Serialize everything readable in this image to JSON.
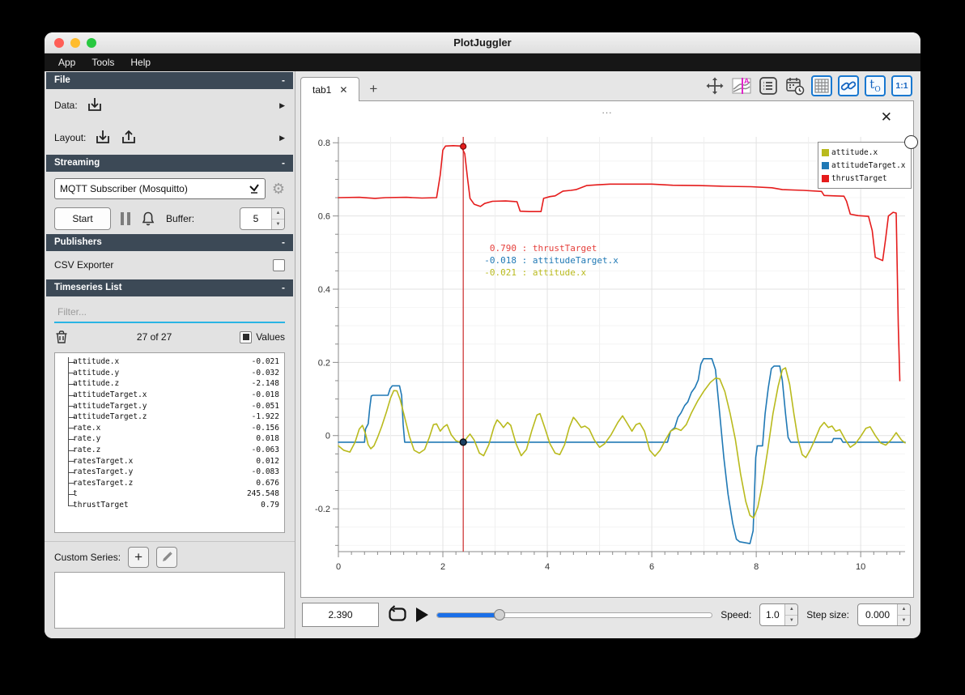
{
  "window": {
    "title": "PlotJuggler",
    "menu": [
      "App",
      "Tools",
      "Help"
    ]
  },
  "icons": {
    "collapse": "-",
    "expander": "▶",
    "gear": "⚙",
    "close": "✕",
    "add": "+",
    "dots": "...",
    "up": "▲",
    "down": "▼"
  },
  "sidebar": {
    "sections": {
      "file": "File",
      "streaming": "Streaming",
      "publishers": "Publishers",
      "timeseries": "Timeseries List"
    },
    "file": {
      "data_label": "Data:",
      "layout_label": "Layout:"
    },
    "streaming": {
      "source": "MQTT Subscriber (Mosquitto)",
      "start_label": "Start",
      "buffer_label": "Buffer:",
      "buffer_value": "5"
    },
    "publishers": {
      "csv_label": "CSV Exporter",
      "csv_checked": false
    },
    "timeseries": {
      "filter_placeholder": "Filter...",
      "count": "27 of 27",
      "values_label": "Values",
      "values_checked": true,
      "items": [
        {
          "name": "attitude.x",
          "value": "-0.021"
        },
        {
          "name": "attitude.y",
          "value": "-0.032"
        },
        {
          "name": "attitude.z",
          "value": "-2.148"
        },
        {
          "name": "attitudeTarget.x",
          "value": "-0.018"
        },
        {
          "name": "attitudeTarget.y",
          "value": "-0.051"
        },
        {
          "name": "attitudeTarget.z",
          "value": "-1.922"
        },
        {
          "name": "rate.x",
          "value": "-0.156"
        },
        {
          "name": "rate.y",
          "value": "0.018"
        },
        {
          "name": "rate.z",
          "value": "-0.063"
        },
        {
          "name": "ratesTarget.x",
          "value": "0.012"
        },
        {
          "name": "ratesTarget.y",
          "value": "-0.083"
        },
        {
          "name": "ratesTarget.z",
          "value": "0.676"
        },
        {
          "name": "t",
          "value": "245.548"
        },
        {
          "name": "thrustTarget",
          "value": "0.79"
        }
      ]
    },
    "custom_series_label": "Custom Series:"
  },
  "tabs": {
    "active": "tab1"
  },
  "toolbar": {
    "t_label": "t",
    "t_sub": "O",
    "ratio_label": "1:1"
  },
  "plot": {
    "title": "...",
    "legend": [
      {
        "label": "attitude.x",
        "color": "#b9ba1d"
      },
      {
        "label": "attitudeTarget.x",
        "color": "#2079b5"
      },
      {
        "label": "thrustTarget",
        "color": "#e51c1c"
      }
    ],
    "tooltip_lines": [
      {
        "num": " 0.790",
        "sep": " : ",
        "label": "thrustTarget",
        "color": "#e5403c"
      },
      {
        "num": "-0.018",
        "sep": " : ",
        "label": "attitudeTarget.x",
        "color": "#2079b5"
      },
      {
        "num": "-0.021",
        "sep": " : ",
        "label": "attitude.x",
        "color": "#b9ba1d"
      }
    ],
    "tracker": {
      "x": 2.39,
      "color": "#cc2a2a",
      "points": [
        {
          "v": 0.79,
          "fill": "#e51c1c",
          "stroke": "#7a1010",
          "r": 3.5
        },
        {
          "v": -0.018,
          "fill": "#1d3f61",
          "stroke": "#0a0a0a",
          "r": 4
        }
      ]
    }
  },
  "chart_data": {
    "type": "line",
    "title": "...",
    "xlabel": "",
    "ylabel": "",
    "xlim": [
      0,
      10.85
    ],
    "ylim": [
      -0.317,
      0.816
    ],
    "x_ticks": [
      0,
      2,
      4,
      6,
      8,
      10
    ],
    "y_ticks": [
      -0.2,
      0,
      0.2,
      0.4,
      0.6,
      0.8
    ],
    "grid": {
      "x_minor": 1,
      "x_major": 2,
      "y_minor": 0.05,
      "y_major": 0.2
    },
    "legend_position": "top-right",
    "series": [
      {
        "name": "thrustTarget",
        "color": "#e51c1c",
        "points": [
          [
            0,
            0.65
          ],
          [
            0.4,
            0.651
          ],
          [
            0.7,
            0.648
          ],
          [
            0.9,
            0.65
          ],
          [
            1.3,
            0.651
          ],
          [
            1.6,
            0.649
          ],
          [
            1.88,
            0.65
          ],
          [
            1.95,
            0.712
          ],
          [
            2.0,
            0.78
          ],
          [
            2.05,
            0.791
          ],
          [
            2.2,
            0.792
          ],
          [
            2.35,
            0.791
          ],
          [
            2.42,
            0.77
          ],
          [
            2.47,
            0.705
          ],
          [
            2.52,
            0.648
          ],
          [
            2.6,
            0.632
          ],
          [
            2.72,
            0.626
          ],
          [
            2.8,
            0.634
          ],
          [
            2.95,
            0.64
          ],
          [
            3.2,
            0.641
          ],
          [
            3.42,
            0.639
          ],
          [
            3.48,
            0.613
          ],
          [
            3.65,
            0.612
          ],
          [
            3.88,
            0.612
          ],
          [
            3.93,
            0.648
          ],
          [
            4.05,
            0.653
          ],
          [
            4.15,
            0.655
          ],
          [
            4.3,
            0.668
          ],
          [
            4.45,
            0.67
          ],
          [
            4.55,
            0.672
          ],
          [
            4.75,
            0.683
          ],
          [
            4.95,
            0.685
          ],
          [
            5.2,
            0.687
          ],
          [
            5.6,
            0.687
          ],
          [
            6.0,
            0.687
          ],
          [
            6.4,
            0.684
          ],
          [
            6.9,
            0.683
          ],
          [
            7.4,
            0.681
          ],
          [
            7.9,
            0.68
          ],
          [
            8.3,
            0.677
          ],
          [
            8.5,
            0.672
          ],
          [
            8.9,
            0.67
          ],
          [
            9.25,
            0.667
          ],
          [
            9.3,
            0.656
          ],
          [
            9.5,
            0.655
          ],
          [
            9.68,
            0.654
          ],
          [
            9.73,
            0.64
          ],
          [
            9.8,
            0.605
          ],
          [
            9.95,
            0.601
          ],
          [
            10.15,
            0.599
          ],
          [
            10.22,
            0.56
          ],
          [
            10.28,
            0.487
          ],
          [
            10.42,
            0.478
          ],
          [
            10.48,
            0.54
          ],
          [
            10.53,
            0.6
          ],
          [
            10.62,
            0.61
          ],
          [
            10.68,
            0.608
          ],
          [
            10.72,
            0.3
          ],
          [
            10.75,
            0.15
          ]
        ]
      },
      {
        "name": "attitudeTarget.x",
        "color": "#2079b5",
        "points": [
          [
            0,
            -0.018
          ],
          [
            0.5,
            -0.018
          ],
          [
            0.52,
            0.018
          ],
          [
            0.57,
            0.032
          ],
          [
            0.6,
            0.075
          ],
          [
            0.63,
            0.108
          ],
          [
            0.66,
            0.11
          ],
          [
            0.95,
            0.11
          ],
          [
            0.99,
            0.128
          ],
          [
            1.03,
            0.136
          ],
          [
            1.17,
            0.136
          ],
          [
            1.21,
            0.11
          ],
          [
            1.24,
            0.03
          ],
          [
            1.27,
            -0.018
          ],
          [
            6.3,
            -0.018
          ],
          [
            6.36,
            0.012
          ],
          [
            6.44,
            0.022
          ],
          [
            6.5,
            0.05
          ],
          [
            6.56,
            0.062
          ],
          [
            6.63,
            0.082
          ],
          [
            6.69,
            0.092
          ],
          [
            6.76,
            0.118
          ],
          [
            6.83,
            0.132
          ],
          [
            6.89,
            0.152
          ],
          [
            6.94,
            0.195
          ],
          [
            6.99,
            0.21
          ],
          [
            7.15,
            0.21
          ],
          [
            7.22,
            0.18
          ],
          [
            7.3,
            0.06
          ],
          [
            7.38,
            -0.06
          ],
          [
            7.46,
            -0.16
          ],
          [
            7.55,
            -0.24
          ],
          [
            7.62,
            -0.283
          ],
          [
            7.68,
            -0.29
          ],
          [
            7.88,
            -0.295
          ],
          [
            7.94,
            -0.26
          ],
          [
            7.99,
            -0.06
          ],
          [
            8.02,
            -0.028
          ],
          [
            8.12,
            -0.028
          ],
          [
            8.17,
            0.06
          ],
          [
            8.23,
            0.13
          ],
          [
            8.29,
            0.183
          ],
          [
            8.34,
            0.19
          ],
          [
            8.45,
            0.19
          ],
          [
            8.5,
            0.15
          ],
          [
            8.56,
            0.06
          ],
          [
            8.61,
            -0.005
          ],
          [
            8.66,
            -0.018
          ],
          [
            9.45,
            -0.018
          ],
          [
            9.48,
            -0.008
          ],
          [
            9.62,
            -0.008
          ],
          [
            9.66,
            -0.018
          ],
          [
            10.85,
            -0.018
          ]
        ]
      },
      {
        "name": "attitude.x",
        "color": "#b9ba1d",
        "points": [
          [
            0,
            -0.028
          ],
          [
            0.1,
            -0.04
          ],
          [
            0.22,
            -0.045
          ],
          [
            0.32,
            -0.018
          ],
          [
            0.4,
            0.018
          ],
          [
            0.46,
            0.028
          ],
          [
            0.52,
            0.005
          ],
          [
            0.57,
            -0.025
          ],
          [
            0.62,
            -0.036
          ],
          [
            0.68,
            -0.028
          ],
          [
            0.75,
            -0.005
          ],
          [
            0.83,
            0.025
          ],
          [
            0.92,
            0.065
          ],
          [
            1.0,
            0.103
          ],
          [
            1.06,
            0.123
          ],
          [
            1.12,
            0.122
          ],
          [
            1.18,
            0.1
          ],
          [
            1.26,
            0.055
          ],
          [
            1.36,
            -0.002
          ],
          [
            1.45,
            -0.04
          ],
          [
            1.55,
            -0.048
          ],
          [
            1.65,
            -0.038
          ],
          [
            1.74,
            -0.005
          ],
          [
            1.82,
            0.03
          ],
          [
            1.88,
            0.032
          ],
          [
            1.95,
            0.012
          ],
          [
            2.02,
            0.024
          ],
          [
            2.08,
            0.03
          ],
          [
            2.16,
            0.002
          ],
          [
            2.25,
            -0.014
          ],
          [
            2.39,
            -0.021
          ],
          [
            2.47,
            -0.004
          ],
          [
            2.52,
            0.004
          ],
          [
            2.6,
            -0.012
          ],
          [
            2.7,
            -0.048
          ],
          [
            2.78,
            -0.055
          ],
          [
            2.88,
            -0.025
          ],
          [
            2.98,
            0.025
          ],
          [
            3.04,
            0.043
          ],
          [
            3.1,
            0.034
          ],
          [
            3.16,
            0.022
          ],
          [
            3.24,
            0.036
          ],
          [
            3.3,
            0.028
          ],
          [
            3.4,
            -0.022
          ],
          [
            3.5,
            -0.055
          ],
          [
            3.6,
            -0.038
          ],
          [
            3.7,
            0.012
          ],
          [
            3.8,
            0.056
          ],
          [
            3.86,
            0.06
          ],
          [
            3.95,
            0.022
          ],
          [
            4.05,
            -0.022
          ],
          [
            4.15,
            -0.048
          ],
          [
            4.24,
            -0.052
          ],
          [
            4.33,
            -0.025
          ],
          [
            4.42,
            0.022
          ],
          [
            4.5,
            0.05
          ],
          [
            4.56,
            0.04
          ],
          [
            4.65,
            0.022
          ],
          [
            4.72,
            0.026
          ],
          [
            4.8,
            0.018
          ],
          [
            4.9,
            -0.012
          ],
          [
            5.0,
            -0.032
          ],
          [
            5.1,
            -0.022
          ],
          [
            5.22,
            0.002
          ],
          [
            5.35,
            0.036
          ],
          [
            5.44,
            0.054
          ],
          [
            5.52,
            0.036
          ],
          [
            5.62,
            0.012
          ],
          [
            5.7,
            0.03
          ],
          [
            5.77,
            0.034
          ],
          [
            5.86,
            0.012
          ],
          [
            5.96,
            -0.04
          ],
          [
            6.06,
            -0.056
          ],
          [
            6.16,
            -0.04
          ],
          [
            6.26,
            -0.012
          ],
          [
            6.36,
            0.012
          ],
          [
            6.46,
            0.02
          ],
          [
            6.56,
            0.014
          ],
          [
            6.66,
            0.03
          ],
          [
            6.76,
            0.062
          ],
          [
            6.88,
            0.095
          ],
          [
            7.0,
            0.122
          ],
          [
            7.12,
            0.145
          ],
          [
            7.22,
            0.157
          ],
          [
            7.3,
            0.155
          ],
          [
            7.4,
            0.12
          ],
          [
            7.5,
            0.06
          ],
          [
            7.6,
            -0.01
          ],
          [
            7.7,
            -0.105
          ],
          [
            7.8,
            -0.18
          ],
          [
            7.88,
            -0.218
          ],
          [
            7.95,
            -0.225
          ],
          [
            8.03,
            -0.195
          ],
          [
            8.12,
            -0.13
          ],
          [
            8.22,
            -0.04
          ],
          [
            8.32,
            0.06
          ],
          [
            8.42,
            0.135
          ],
          [
            8.5,
            0.18
          ],
          [
            8.56,
            0.185
          ],
          [
            8.64,
            0.14
          ],
          [
            8.72,
            0.06
          ],
          [
            8.8,
            -0.01
          ],
          [
            8.88,
            -0.052
          ],
          [
            8.95,
            -0.06
          ],
          [
            9.03,
            -0.04
          ],
          [
            9.12,
            -0.012
          ],
          [
            9.22,
            0.022
          ],
          [
            9.3,
            0.036
          ],
          [
            9.38,
            0.022
          ],
          [
            9.45,
            0.026
          ],
          [
            9.52,
            0.012
          ],
          [
            9.6,
            0.016
          ],
          [
            9.7,
            -0.01
          ],
          [
            9.8,
            -0.032
          ],
          [
            9.9,
            -0.022
          ],
          [
            10.0,
            -0.002
          ],
          [
            10.1,
            0.02
          ],
          [
            10.18,
            0.024
          ],
          [
            10.28,
            0.0
          ],
          [
            10.38,
            -0.02
          ],
          [
            10.48,
            -0.026
          ],
          [
            10.58,
            -0.012
          ],
          [
            10.68,
            0.008
          ],
          [
            10.78,
            -0.012
          ],
          [
            10.85,
            -0.02
          ]
        ]
      }
    ]
  },
  "controls": {
    "time": "2.390",
    "slider_fraction": 0.23,
    "speed_label": "Speed:",
    "speed": "1.0",
    "step_label": "Step size:",
    "step": "0.000"
  }
}
